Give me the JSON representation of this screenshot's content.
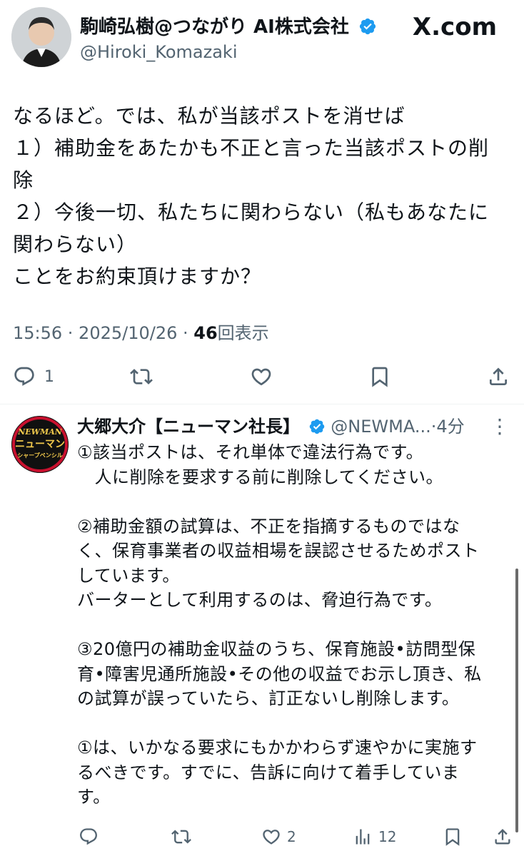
{
  "main_tweet": {
    "author_name": "駒崎弘樹@つながり AI株式会社",
    "author_handle": "@Hiroki_Komazaki",
    "watermark": "X.com",
    "body": "なるほど。では、私が当該ポストを消せば\n１）補助金をあたかも不正と言った当該ポストの削\n除\n２）今後一切、私たちに関わらない（私もあなたに\n関わらない）\nことをお約束頂けますか？",
    "time": "15:56 · 2025/10/26 · ",
    "views_count": "46",
    "views_label": "回表示",
    "actions": {
      "reply_count": "1",
      "retweet_count": "",
      "like_count": "",
      "bookmark_count": ""
    }
  },
  "reply_tweet": {
    "author_name": "大郷大介【ニューマン社長】",
    "author_handle": "@NEWMA...",
    "time_ago": "·4分",
    "more": "⋮",
    "avatar_text_top": "NEWMAN",
    "avatar_text_mid": "ニューマン",
    "avatar_text_bot": "シャープペンシル",
    "body": "①該当ポストは、それ単体で違法行為です。\n　人に削除を要求する前に削除してください。\n\n②補助金額の試算は、不正を指摘するものではな\nく、保育事業者の収益相場を誤認させるためポスト\nしています。\nバーターとして利用するのは、脅迫行為です。\n\n③20億円の補助金収益のうち、保育施設•訪問型保\n育•障害児通所施設•その他の収益でお示し頂き、私\nの試算が誤っていたら、訂正ないし削除します。\n\n①は、いかなる要求にもかかわらず速やかに実施す\nるべきです。すでに、告訴に向けて着手していま\nす。",
    "actions": {
      "reply_count": "",
      "retweet_count": "",
      "like_count": "2",
      "views_count": "12",
      "bookmark_count": ""
    }
  },
  "colors": {
    "text": "#0f1419",
    "secondary": "#536471",
    "verified": "#1d9bf0",
    "divider": "#eff3f4"
  }
}
